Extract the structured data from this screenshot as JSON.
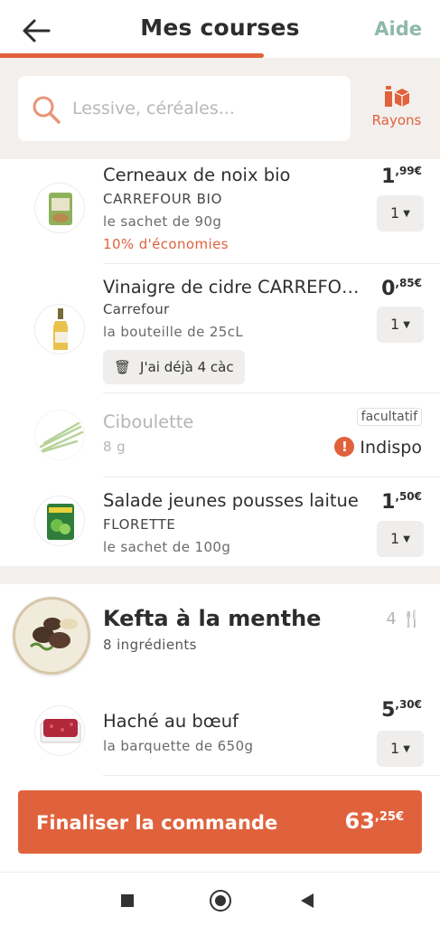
{
  "header": {
    "title": "Mes courses",
    "help_label": "Aide"
  },
  "search": {
    "placeholder": "Lessive, céréales...",
    "rayons_label": "Rayons"
  },
  "items": [
    {
      "name": "Cerneaux de noix bio",
      "brand": "CARREFOUR BIO",
      "quantity_text": "le sachet de 90g",
      "promo": "10% d'économies",
      "price_int": "1",
      "price_dec": ",99€",
      "qty": "1"
    },
    {
      "name": "Vinaigre de cidre CARREFOUR",
      "brand": "Carrefour",
      "quantity_text": "la bouteille de 25cL",
      "chip": "J'ai déjà 4 càc",
      "price_int": "0",
      "price_dec": ",85€",
      "qty": "1"
    },
    {
      "name": "Ciboulette",
      "quantity_text": "8 g",
      "optional_badge": "facultatif",
      "status": "Indispo",
      "status_mark": "!"
    },
    {
      "name": "Salade jeunes pousses laitue",
      "brand": "FLORETTE",
      "quantity_text": "le sachet de 100g",
      "price_int": "1",
      "price_dec": ",50€",
      "qty": "1"
    }
  ],
  "recipe": {
    "title": "Kefta à la menthe",
    "subtitle": "8 ingrédients",
    "servings": "4",
    "servings_icon": "cutlery-icon"
  },
  "recipe_items": [
    {
      "name": "Haché au bœuf",
      "quantity_text": "la barquette de 650g",
      "price_int": "5",
      "price_dec": ",30€",
      "qty": "1"
    }
  ],
  "cta": {
    "label": "Finaliser la commande",
    "price_int": "63",
    "price_dec": ",25€"
  },
  "colors": {
    "accent": "#e0623c",
    "help": "#8fb8a8",
    "band": "#f2efec"
  }
}
